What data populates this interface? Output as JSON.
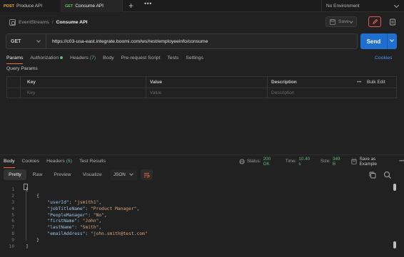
{
  "tabs": [
    {
      "method": "POST",
      "label": "Produce API"
    },
    {
      "method": "GET",
      "label": "Consume API"
    }
  ],
  "tab_add_symbol": "+",
  "tab_more_symbol": "•••",
  "environment": {
    "label": "No Environment"
  },
  "breadcrumb": {
    "collection": "EventStreams",
    "separator": "/",
    "title": "Consume API"
  },
  "save": {
    "label": "Save"
  },
  "request": {
    "method": "GET",
    "url": "https://c03-usa-east.integrate.boomi.com/ws/rest/employeeinfo/consume",
    "send_label": "Send"
  },
  "request_tabs": [
    {
      "label": "Params",
      "active": true
    },
    {
      "label": "Authorization",
      "indicator": "green-dot"
    },
    {
      "label": "Headers",
      "count": "(7)"
    },
    {
      "label": "Body"
    },
    {
      "label": "Pre-request Script"
    },
    {
      "label": "Tests"
    },
    {
      "label": "Settings"
    }
  ],
  "cookies_link": "Cookies",
  "query_params": {
    "label": "Query Params",
    "columns": [
      "Key",
      "Value",
      "Description"
    ],
    "bulk_edit": "Bulk Edit",
    "more_symbol": "•••",
    "placeholders": [
      "Key",
      "Value",
      "Description"
    ]
  },
  "response_tabs": [
    {
      "label": "Body",
      "active": true
    },
    {
      "label": "Cookies"
    },
    {
      "label": "Headers",
      "count": "(5)"
    },
    {
      "label": "Test Results"
    }
  ],
  "response_status": {
    "status_label": "Status:",
    "status_value": "200 OK",
    "time_label": "Time:",
    "time_value": "10.40 s",
    "size_label": "Size:",
    "size_value": "349 B",
    "save_example": "Save as Example",
    "more_symbol": "•••"
  },
  "format_tabs": [
    {
      "label": "Pretty",
      "active": true
    },
    {
      "label": "Raw"
    },
    {
      "label": "Preview"
    },
    {
      "label": "Visualize"
    }
  ],
  "format_select": "JSON",
  "code_lines": [
    {
      "n": "1",
      "t": "[",
      "kind": "p"
    },
    {
      "n": "2",
      "t": "    {",
      "kind": "p"
    },
    {
      "n": "3",
      "key": "\"userId\"",
      "val": "\"jsmith1\""
    },
    {
      "n": "4",
      "key": "\"jobTitleName\"",
      "val": "\"Product Manager\""
    },
    {
      "n": "5",
      "key": "\"PeopleManager\"",
      "val": "\"No\""
    },
    {
      "n": "6",
      "key": "\"firstName\"",
      "val": "\"John\""
    },
    {
      "n": "7",
      "key": "\"lastName\"",
      "val": "\"Smith\""
    },
    {
      "n": "8",
      "key": "\"emailAddress\"",
      "val": "\"john.smith@test.com\"",
      "last": true
    },
    {
      "n": "9",
      "t": "    }",
      "kind": "p"
    },
    {
      "n": "10",
      "t": "]",
      "kind": "p"
    }
  ],
  "colors": {
    "accent": "#f26b3a",
    "send": "#1f6fd1",
    "ok": "#5fb97d",
    "link": "#4a9cf5"
  }
}
